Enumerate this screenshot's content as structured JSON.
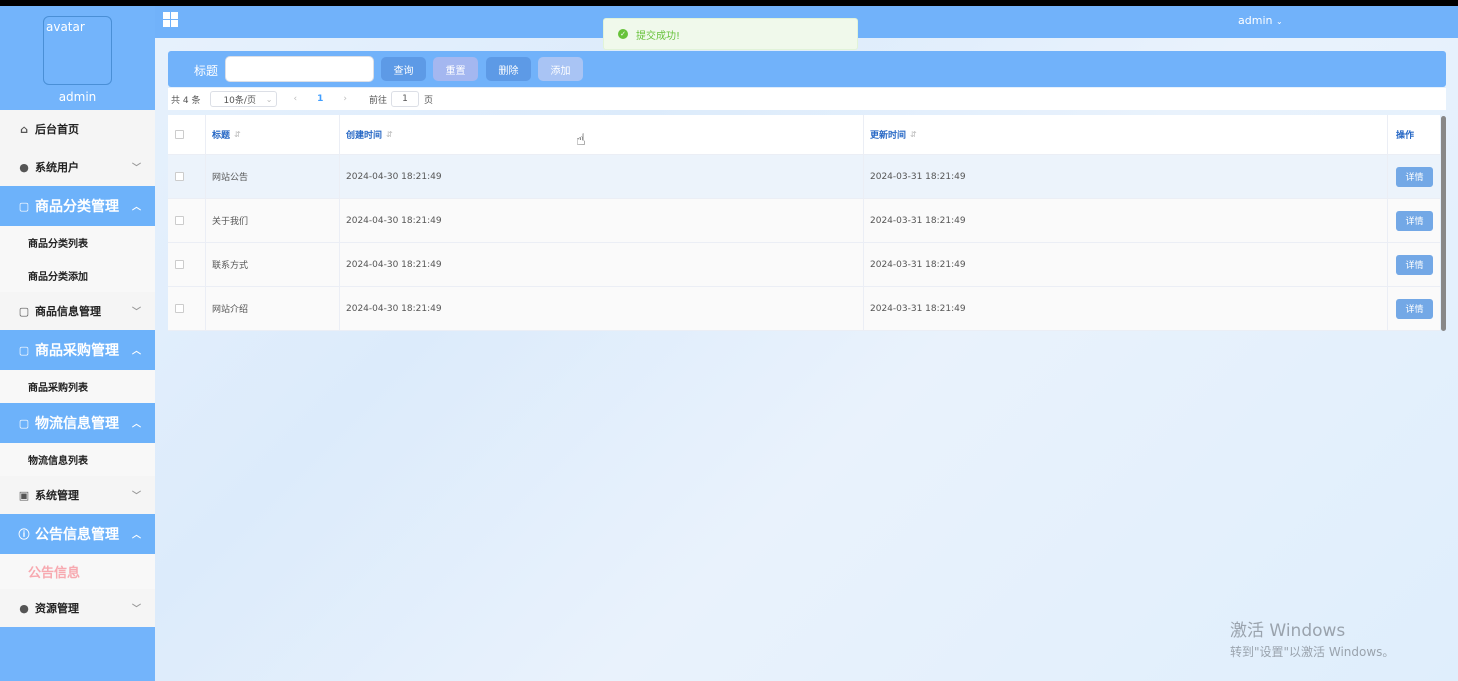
{
  "sidebar": {
    "avatar_alt": "avatar",
    "username": "admin",
    "menu": {
      "home": "后台首页",
      "system_users": "系统用户",
      "category_mgmt": "商品分类管理",
      "category_list": "商品分类列表",
      "category_add": "商品分类添加",
      "goods_info": "商品信息管理",
      "purchase_mgmt": "商品采购管理",
      "purchase_list": "商品采购列表",
      "logistics_mgmt": "物流信息管理",
      "logistics_list": "物流信息列表",
      "system_mgmt": "系统管理",
      "notice_mgmt": "公告信息管理",
      "notice_info": "公告信息",
      "resource_mgmt": "资源管理"
    }
  },
  "header": {
    "site_title": "",
    "user": "admin"
  },
  "toast": {
    "message": "提交成功!"
  },
  "search": {
    "label": "标题",
    "value": "",
    "buttons": {
      "query": "查询",
      "reset": "重置",
      "delete": "删除",
      "add": "添加"
    }
  },
  "pagination": {
    "total": "共 4 条",
    "page_size": "10条/页",
    "current_page": "1",
    "goto_label": "前往",
    "goto_value": "1",
    "page_unit": "页"
  },
  "table": {
    "headers": {
      "title": "标题",
      "created": "创建时间",
      "updated": "更新时间",
      "actions": "操作"
    },
    "rows": [
      {
        "title": "网站公告",
        "created": "2024-04-30 18:21:49",
        "updated": "2024-03-31 18:21:49",
        "action": "详情"
      },
      {
        "title": "关于我们",
        "created": "2024-04-30 18:21:49",
        "updated": "2024-03-31 18:21:49",
        "action": "详情"
      },
      {
        "title": "联系方式",
        "created": "2024-04-30 18:21:49",
        "updated": "2024-03-31 18:21:49",
        "action": "详情"
      },
      {
        "title": "网站介绍",
        "created": "2024-04-30 18:21:49",
        "updated": "2024-03-31 18:21:49",
        "action": "详情"
      }
    ]
  },
  "watermark": {
    "line1": "激活 Windows",
    "line2": "转到\"设置\"以激活 Windows。"
  },
  "colors": {
    "primary": "#71b2fa",
    "success": "#67c23a",
    "active_sub": "#f7a9b0"
  }
}
